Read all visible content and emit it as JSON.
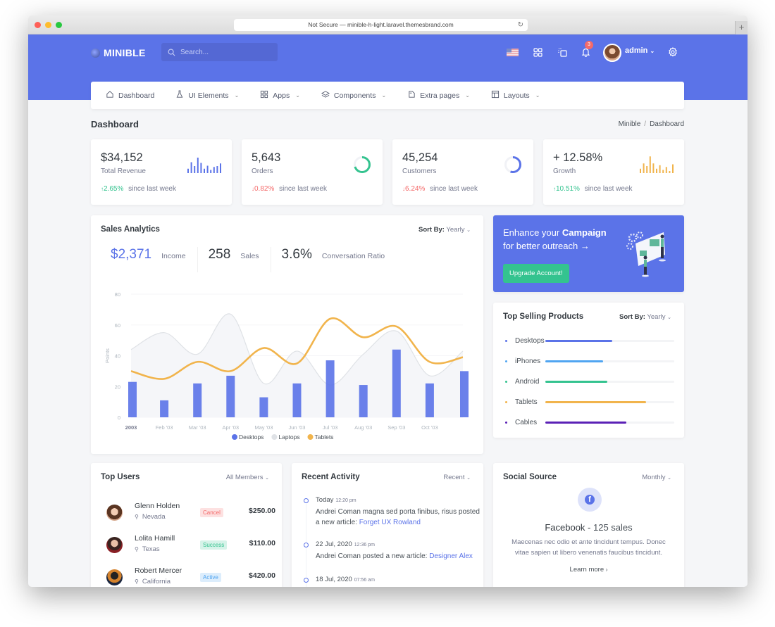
{
  "browser": {
    "url": "Not Secure — minible-h-light.laravel.themesbrand.com"
  },
  "header": {
    "logo": "MINIBLE",
    "search_placeholder": "Search...",
    "notification_count": "3",
    "user_name": "admin"
  },
  "nav": [
    {
      "label": "Dashboard",
      "icon": "home-icon",
      "dropdown": false
    },
    {
      "label": "UI Elements",
      "icon": "flask-icon",
      "dropdown": true
    },
    {
      "label": "Apps",
      "icon": "apps-grid-icon",
      "dropdown": true
    },
    {
      "label": "Components",
      "icon": "layers-icon",
      "dropdown": true
    },
    {
      "label": "Extra pages",
      "icon": "pages-icon",
      "dropdown": true
    },
    {
      "label": "Layouts",
      "icon": "layout-icon",
      "dropdown": true
    }
  ],
  "page": {
    "title": "Dashboard",
    "breadcrumb": [
      "Minible",
      "Dashboard"
    ]
  },
  "stats": [
    {
      "value": "$34,152",
      "label": "Total Revenue",
      "delta": "2.65%",
      "trend": "up",
      "since": "since last week",
      "mini": "bars",
      "mini_values": [
        25,
        62,
        40,
        88,
        58,
        25,
        42,
        18,
        35,
        40,
        55
      ],
      "color": "#5b73e8"
    },
    {
      "value": "5,643",
      "label": "Orders",
      "delta": "0.82%",
      "trend": "down",
      "since": "since last week",
      "mini": "radial",
      "percent": 70,
      "color": "#34c38f"
    },
    {
      "value": "45,254",
      "label": "Customers",
      "delta": "6.24%",
      "trend": "down",
      "since": "since last week",
      "mini": "radial",
      "percent": 55,
      "color": "#5b73e8"
    },
    {
      "value": "+ 12.58%",
      "label": "Growth",
      "delta": "10.51%",
      "trend": "up",
      "since": "since last week",
      "mini": "bars",
      "mini_values": [
        25,
        55,
        40,
        95,
        55,
        25,
        45,
        18,
        35,
        12,
        50
      ],
      "color": "#f1b44c"
    }
  ],
  "sales_analytics": {
    "title": "Sales Analytics",
    "sort_label": "Sort By:",
    "sort_value": "Yearly",
    "metrics": [
      {
        "value": "$2,371",
        "label": "Income"
      },
      {
        "value": "258",
        "label": "Sales"
      },
      {
        "value": "3.6%",
        "label": "Conversation Ratio"
      }
    ]
  },
  "chart_data": {
    "type": "bar",
    "title": "",
    "xlabel": "",
    "ylabel": "Points",
    "ylim": [
      0,
      80
    ],
    "yticks": [
      0,
      20,
      40,
      60,
      80
    ],
    "categories": [
      "2003",
      "Feb '03",
      "Mar '03",
      "Apr '03",
      "May '03",
      "Jun '03",
      "Jul '03",
      "Aug '03",
      "Sep '03",
      "Oct '03",
      ""
    ],
    "series": [
      {
        "name": "Desktops",
        "kind": "bar",
        "color": "#5b73e8",
        "values": [
          23,
          11,
          22,
          27,
          13,
          22,
          37,
          21,
          44,
          22,
          30
        ]
      },
      {
        "name": "Laptops",
        "kind": "area",
        "color": "#dfe2e6",
        "values": [
          44,
          55,
          41,
          67,
          22,
          43,
          21,
          41,
          56,
          27,
          43
        ]
      },
      {
        "name": "Tablets",
        "kind": "line",
        "color": "#f1b44c",
        "values": [
          30,
          25,
          36,
          30,
          45,
          35,
          64,
          52,
          59,
          36,
          39
        ]
      }
    ],
    "legend": "bottom-center",
    "grid": true
  },
  "promo": {
    "line1": "Enhance your ",
    "bold": "Campaign",
    "line2": "for better outreach →",
    "button": "Upgrade Account!"
  },
  "top_selling": {
    "title": "Top Selling Products",
    "sort_label": "Sort By:",
    "sort_value": "Yearly",
    "products": [
      {
        "name": "Desktops",
        "percent": 52,
        "color": "#5b73e8"
      },
      {
        "name": "iPhones",
        "percent": 45,
        "color": "#50a5f1"
      },
      {
        "name": "Android",
        "percent": 48,
        "color": "#34c38f"
      },
      {
        "name": "Tablets",
        "percent": 78,
        "color": "#f1b44c"
      },
      {
        "name": "Cables",
        "percent": 63,
        "color": "#5b21b6"
      }
    ]
  },
  "top_users": {
    "title": "Top Users",
    "filter": "All Members",
    "users": [
      {
        "name": "Glenn Holden",
        "location": "Nevada",
        "status": "Cancel",
        "amount": "$250.00"
      },
      {
        "name": "Lolita Hamill",
        "location": "Texas",
        "status": "Success",
        "amount": "$110.00"
      },
      {
        "name": "Robert Mercer",
        "location": "California",
        "status": "Active",
        "amount": "$420.00"
      }
    ]
  },
  "recent_activity": {
    "title": "Recent Activity",
    "filter": "Recent",
    "items": [
      {
        "date": "Today",
        "time": "12:20 pm",
        "text": "Andrei Coman magna sed porta finibus, risus posted a new article: ",
        "link": "Forget UX Rowland"
      },
      {
        "date": "22 Jul, 2020",
        "time": "12:36 pm",
        "text": "Andrei Coman posted a new article: ",
        "link": "Designer Alex"
      },
      {
        "date": "18 Jul, 2020",
        "time": "07:56 am",
        "text": "",
        "link": ""
      }
    ]
  },
  "social_source": {
    "title": "Social Source",
    "filter": "Monthly",
    "network": "Facebook",
    "sales": "125 sales",
    "description": "Maecenas nec odio et ante tincidunt tempus. Donec vitae sapien ut libero venenatis faucibus tincidunt.",
    "link": "Learn more"
  }
}
